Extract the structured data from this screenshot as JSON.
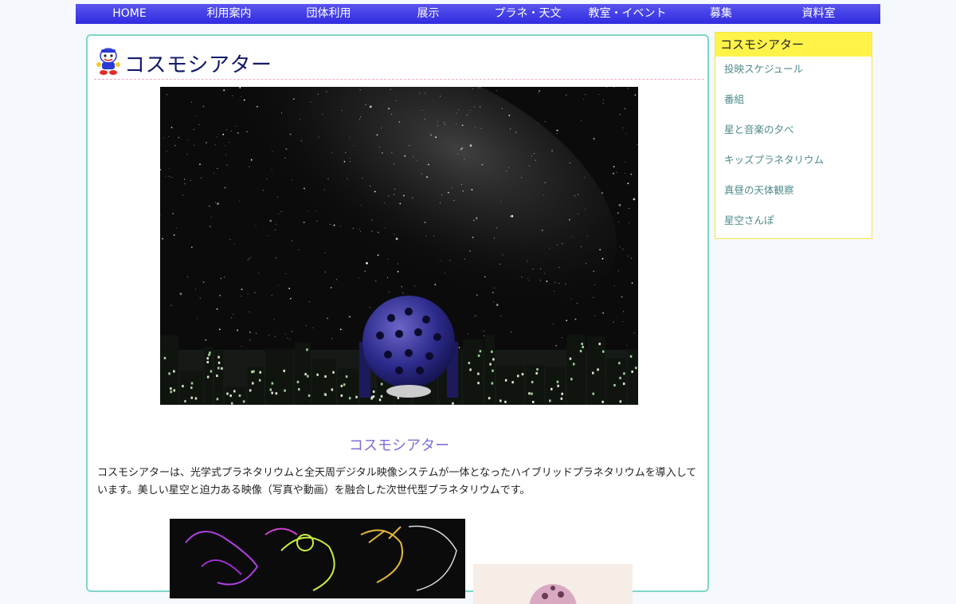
{
  "nav": {
    "items": [
      "HOME",
      "利用案内",
      "団体利用",
      "展示",
      "プラネ・天文",
      "教室・イベント",
      "募集",
      "資料室"
    ]
  },
  "main": {
    "title": "コスモシアター",
    "section_heading": "コスモシアター",
    "body_text": "コスモシアターは、光学式プラネタリウムと全天周デジタル映像システムが一体となったハイブリッドプラネタリウムを導入しています。美しい星空と迫力ある映像（写真や動画）を融合した次世代型プラネタリウムです。"
  },
  "sidebar": {
    "title": "コスモシアター",
    "items": [
      "投映スケジュール",
      "番組",
      "星と音楽の夕べ",
      "キッズプラネタリウム",
      "真昼の天体観察",
      "星空さんぽ"
    ]
  },
  "colors": {
    "nav_bg": "#3a36e6",
    "panel_border": "#7fd6c8",
    "title": "#141a6b",
    "section_heading": "#7b6fd8",
    "sidebar_title_bg": "#fff34a",
    "sidebar_link": "#4f8a8a"
  }
}
